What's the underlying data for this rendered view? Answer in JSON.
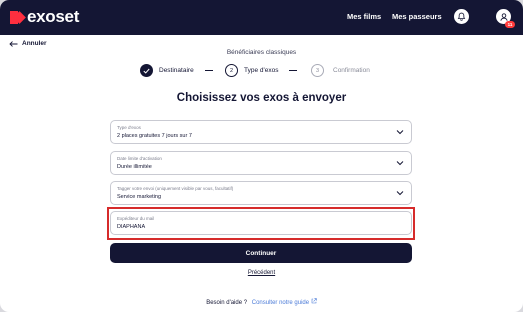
{
  "header": {
    "logo_text": "exoset",
    "nav": {
      "films": "Mes films",
      "passeurs": "Mes passeurs"
    },
    "notification_badge": "11",
    "brand_color": "#141634",
    "accent_color": "#ff2f3f",
    "icons": {
      "bell": "bell-icon",
      "user": "user-icon"
    }
  },
  "back": {
    "label": "Annuler",
    "icon": "arrow-left-icon"
  },
  "subtitle": "Bénéficiaires classiques",
  "stepper": {
    "steps": [
      {
        "number": "1",
        "label": "Destinataire",
        "state": "done"
      },
      {
        "number": "2",
        "label": "Type d'exos",
        "state": "current"
      },
      {
        "number": "3",
        "label": "Confirmation",
        "state": "upcoming"
      }
    ]
  },
  "heading": "Choisissez vos exos à envoyer",
  "form": {
    "type": {
      "label": "Type d'exos",
      "value": "2 places gratuites 7 jours sur 7"
    },
    "duree": {
      "label": "Date limite d'activation",
      "value": "Durée illimitée"
    },
    "tag": {
      "label": "Tagger votre envoi (uniquement visible par vous, facultatif)",
      "value": "Service marketing"
    },
    "expediteur": {
      "label": "Expéditeur du mail",
      "value": "DIAPHANA"
    }
  },
  "highlight_color": "#d62b2b",
  "actions": {
    "continue": "Continuer",
    "previous": "Précédent"
  },
  "help": {
    "question": "Besoin d'aide ?",
    "link": "Consulter notre guide",
    "link_icon": "external-link-icon"
  }
}
